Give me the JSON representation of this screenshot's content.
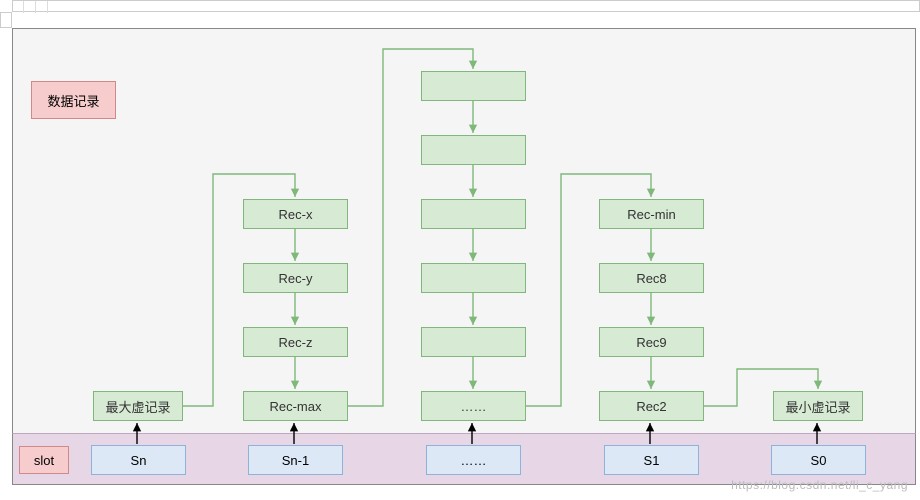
{
  "legend": {
    "title": "数据记录"
  },
  "slot_label": "slot",
  "columns": {
    "col_sn": {
      "boxes": [
        "最大虚记录"
      ],
      "slot": "Sn"
    },
    "col_sn1": {
      "boxes": [
        "Rec-x",
        "Rec-y",
        "Rec-z",
        "Rec-max"
      ],
      "slot": "Sn-1"
    },
    "col_mid": {
      "boxes": [
        "",
        "",
        "",
        "",
        "",
        "……"
      ],
      "slot": "……"
    },
    "col_s1": {
      "boxes": [
        "Rec-min",
        "Rec8",
        "Rec9",
        "Rec2"
      ],
      "slot": "S1"
    },
    "col_s0": {
      "boxes": [
        "最小虚记录"
      ],
      "slot": "S0"
    }
  },
  "watermark": "https://blog.csdn.net/li_c_yang",
  "colors": {
    "green_fill": "#d7ead4",
    "green_stroke": "#7fb87a",
    "blue_fill": "#dce8f6",
    "blue_stroke": "#8fb2d9",
    "pink_fill": "#f6cccc",
    "pink_stroke": "#d08888"
  }
}
